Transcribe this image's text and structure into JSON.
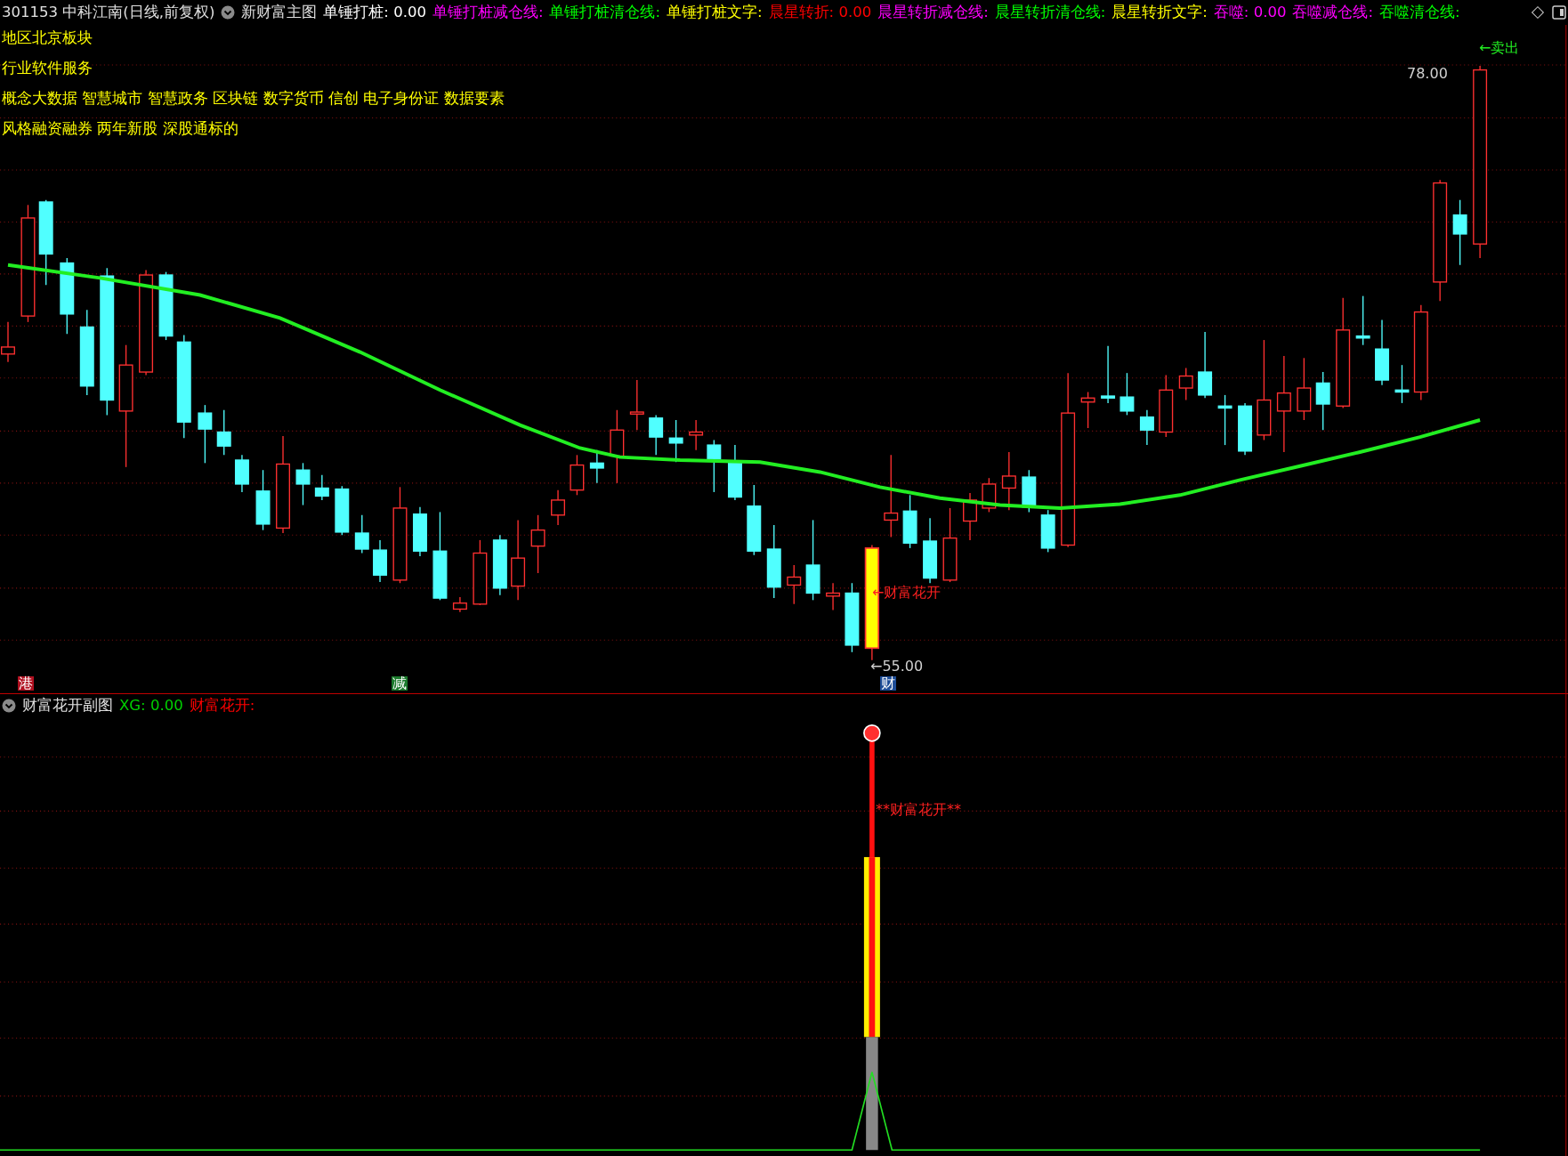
{
  "header": {
    "symbol": "301153 中科江南(日线,前复权)",
    "indicator": "新财富主图",
    "items": [
      {
        "label": "单锤打桩:",
        "value": "0.00",
        "color": "#ffffff"
      },
      {
        "label": "单锤打桩减仓线:",
        "color": "#ff00ff"
      },
      {
        "label": "单锤打桩清仓线:",
        "color": "#00ff00"
      },
      {
        "label": "单锤打桩文字:",
        "color": "#ffff00"
      },
      {
        "label": "晨星转折:",
        "value": "0.00",
        "color": "#ff0000"
      },
      {
        "label": "晨星转折减仓线:",
        "color": "#ff00ff"
      },
      {
        "label": "晨星转折清仓线:",
        "color": "#00ff00"
      },
      {
        "label": "晨星转折文字:",
        "color": "#ffff00"
      },
      {
        "label": "吞噬:",
        "value": "0.00",
        "color": "#ff00ff"
      },
      {
        "label": "吞噬减仓线:",
        "color": "#ff00ff"
      },
      {
        "label": "吞噬清仓线:",
        "color": "#00ff00"
      }
    ]
  },
  "info_lines": [
    "地区北京板块",
    "行业软件服务",
    "概念大数据 智慧城市 智慧政务 区块链 数字货币 信创 电子身份证 数据要素",
    "风格融资融券 两年新股 深股通标的"
  ],
  "annotations": {
    "sell": "←卖出",
    "high": "78.00",
    "signal": "←财富花开",
    "low": "←55.00"
  },
  "markers": [
    {
      "text": "港",
      "color": "#b01020"
    },
    {
      "text": "减",
      "color": "#1b7a2c"
    },
    {
      "text": "财",
      "color": "#1d4c96"
    }
  ],
  "sub_chart": {
    "title": "财富花开副图",
    "items": [
      {
        "label": "XG:",
        "value": "0.00",
        "color": "#00d000"
      },
      {
        "label": "财富花开:",
        "color": "#ff0000"
      }
    ],
    "annotation": "**财富花开**"
  }
}
